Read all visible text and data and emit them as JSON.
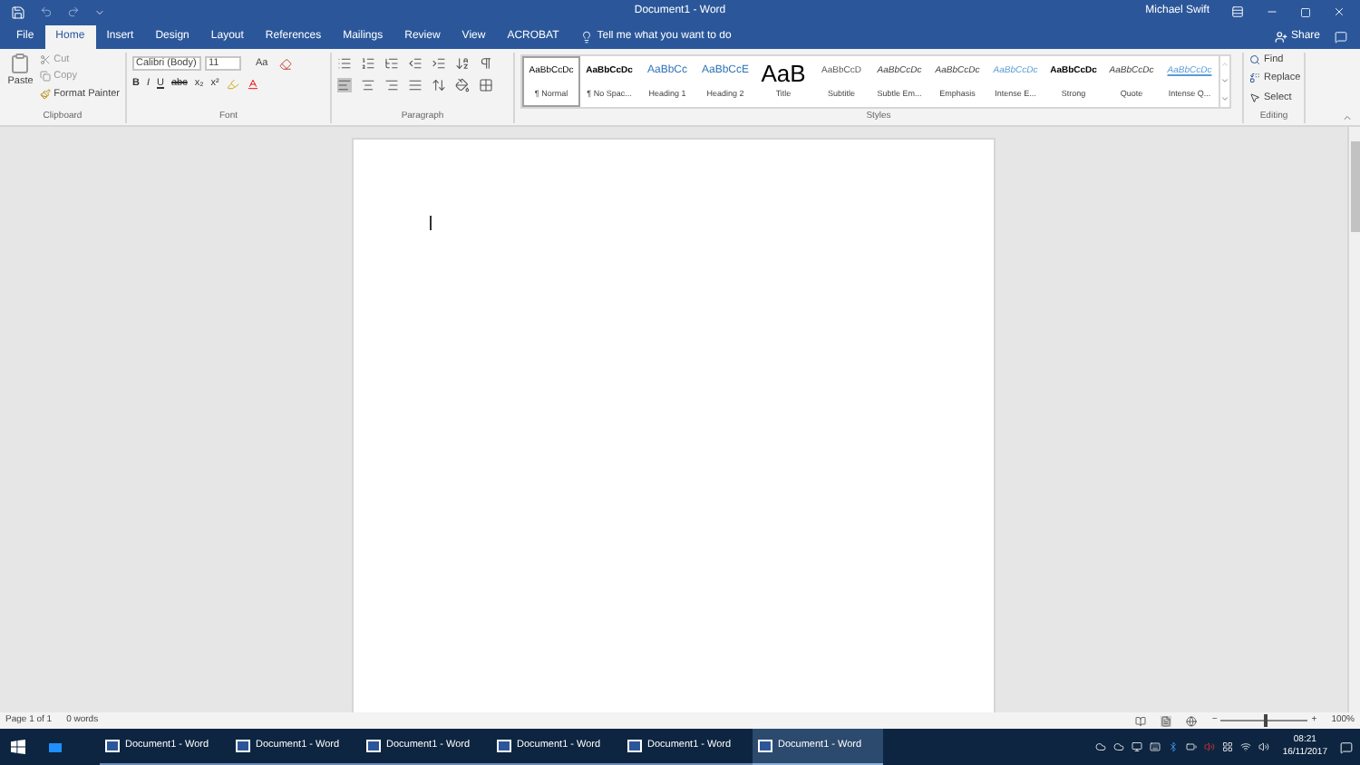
{
  "window": {
    "title": "Document1 - Word",
    "user": "Michael Swift"
  },
  "tabs": [
    {
      "label": "File",
      "selected": false
    },
    {
      "label": "Home",
      "selected": true
    },
    {
      "label": "Insert",
      "selected": false
    },
    {
      "label": "Design",
      "selected": false
    },
    {
      "label": "Layout",
      "selected": false
    },
    {
      "label": "References",
      "selected": false
    },
    {
      "label": "Mailings",
      "selected": false
    },
    {
      "label": "Review",
      "selected": false
    },
    {
      "label": "View",
      "selected": false
    },
    {
      "label": "ACROBAT",
      "selected": false
    }
  ],
  "tell_me": {
    "placeholder": "Tell me what you want to do"
  },
  "share": "Share",
  "clipboard": {
    "label": "Clipboard",
    "paste": "Paste",
    "cut": "Cut",
    "copy": "Copy",
    "format_painter": "Format Painter"
  },
  "font": {
    "label": "Font",
    "name": "Calibri (Body)",
    "size": "11",
    "case": "Aa",
    "buttons": [
      "B",
      "I",
      "U",
      "abc",
      "x₂",
      "x²"
    ]
  },
  "paragraph": {
    "label": "Paragraph"
  },
  "styles": {
    "label": "Styles",
    "items": [
      {
        "sample": "AaBbCcDc",
        "name": "¶ Normal",
        "selected": true,
        "kind": "normal"
      },
      {
        "sample": "AaBbCcDc",
        "name": "¶ No Spac...",
        "selected": false,
        "kind": "bold"
      },
      {
        "sample": "AaBbCc",
        "name": "Heading 1",
        "selected": false,
        "kind": "heading"
      },
      {
        "sample": "AaBbCcE",
        "name": "Heading 2",
        "selected": false,
        "kind": "heading"
      },
      {
        "sample": "AaB",
        "name": "Title",
        "selected": false,
        "kind": "title"
      },
      {
        "sample": "AaBbCcD",
        "name": "Subtitle",
        "selected": false,
        "kind": "subtle"
      },
      {
        "sample": "AaBbCcDc",
        "name": "Subtle Em...",
        "selected": false,
        "kind": "italic"
      },
      {
        "sample": "AaBbCcDc",
        "name": "Emphasis",
        "selected": false,
        "kind": "italic"
      },
      {
        "sample": "AaBbCcDc",
        "name": "Intense E...",
        "selected": false,
        "kind": "accent"
      },
      {
        "sample": "AaBbCcDc",
        "name": "Strong",
        "selected": false,
        "kind": "bold"
      },
      {
        "sample": "AaBbCcDc",
        "name": "Quote",
        "selected": false,
        "kind": "italic"
      },
      {
        "sample": "AaBbCcDc",
        "name": "Intense Q...",
        "selected": false,
        "kind": "quote"
      }
    ]
  },
  "editing": {
    "label": "Editing",
    "find": "Find",
    "replace": "Replace",
    "select": "Select"
  },
  "status_bar": {
    "page": "Page 1 of 1",
    "words": "0 words",
    "zoom_out": "−",
    "zoom_in": "+",
    "zoom": {
      "level": 0.5
    },
    "zoom_text": "100%"
  },
  "taskbar": {
    "items": [
      {
        "label": "Document1 - Word",
        "selected": false
      },
      {
        "label": "Document1 - Word",
        "selected": false
      },
      {
        "label": "Document1 - Word",
        "selected": false
      },
      {
        "label": "Document1 - Word",
        "selected": false
      },
      {
        "label": "Document1 - Word",
        "selected": false
      },
      {
        "label": "Document1 - Word",
        "selected": true
      }
    ],
    "time": "08:21",
    "date": "16/11/2017"
  }
}
